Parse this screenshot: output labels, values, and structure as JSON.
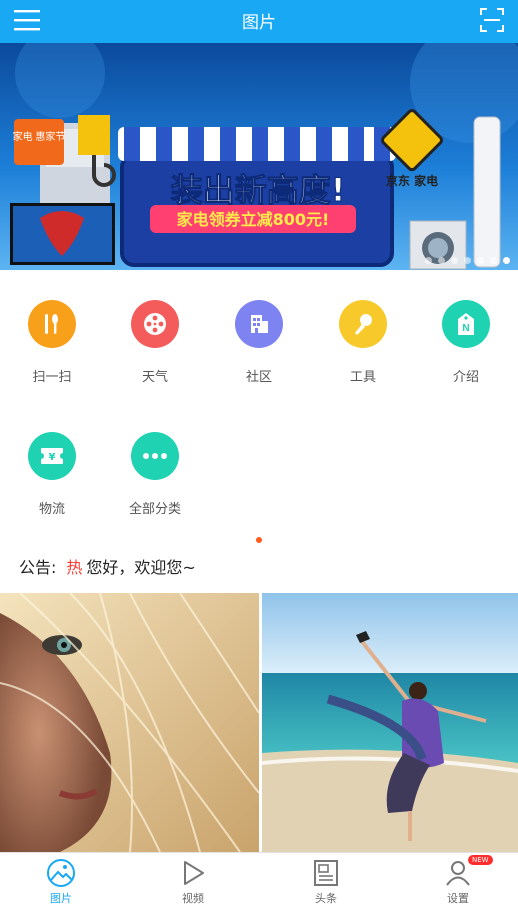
{
  "header": {
    "title": "图片",
    "menu_icon": "menu-icon",
    "scan_icon": "scan-icon",
    "color": "#19a9f4"
  },
  "banner": {
    "badge": "家电 惠家节",
    "headline": "装出新高度!",
    "coupon": "家电领券立减800元!",
    "sign": "京东 家电"
  },
  "grid": [
    {
      "label": "扫一扫",
      "icon": "utensils-icon",
      "color": "#f9a01b"
    },
    {
      "label": "天气",
      "icon": "film-reel-icon",
      "color": "#f45b5b"
    },
    {
      "label": "社区",
      "icon": "building-icon",
      "color": "#7d83f0"
    },
    {
      "label": "工具",
      "icon": "microphone-icon",
      "color": "#f7c92a"
    },
    {
      "label": "介绍",
      "icon": "tag-icon",
      "color": "#1ed2b2"
    },
    {
      "label": "物流",
      "icon": "ticket-icon",
      "color": "#1ed2b2"
    },
    {
      "label": "全部分类",
      "icon": "more-icon",
      "color": "#1ed2b2"
    }
  ],
  "notice": {
    "label": "公告:",
    "hot": "热",
    "text": "您好，欢迎您~"
  },
  "tabs": [
    {
      "label": "图片",
      "icon": "image-icon",
      "active": true
    },
    {
      "label": "视频",
      "icon": "play-icon",
      "active": false
    },
    {
      "label": "头条",
      "icon": "news-icon",
      "active": false
    },
    {
      "label": "设置",
      "icon": "user-icon",
      "active": false,
      "badge": "NEW"
    }
  ]
}
